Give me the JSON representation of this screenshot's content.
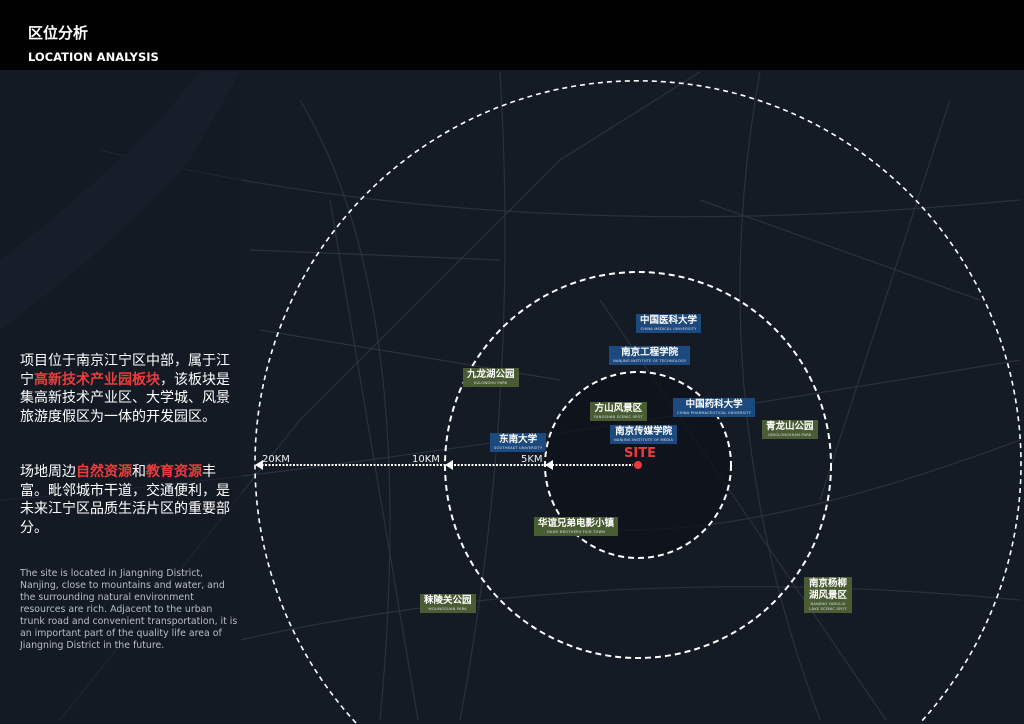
{
  "header": {
    "title_cn": "区位分析",
    "title_en": "LOCATION ANALYSIS"
  },
  "description": {
    "p1_a": "项目位于南京江宁区中部，属于江宁",
    "p1_hl": "高新技术产业园板块",
    "p1_b": "，该板块是集高新技术产业区、大学城、风景旅游度假区为一体的开发园区。",
    "p2_a": "场地周边",
    "p2_hl1": "自然资源",
    "p2_mid": "和",
    "p2_hl2": "教育资源",
    "p2_b": "丰富。毗邻城市干道，交通便利，是未来江宁区品质生活片区的重要部分。",
    "english": "The site is located in Jiangning District, Nanjing, close to mountains and water, and the surrounding natural environment resources are rich. Adjacent to the urban trunk road and convenient transportation, it is an important part of the quality life area of Jiangning District in the future."
  },
  "map": {
    "site_label": "SITE",
    "rings": [
      "5KM",
      "10KM",
      "20KM"
    ],
    "accent": "#ec3b3b",
    "labels": [
      {
        "cn": "中国医科大学",
        "en": "CHINA MEDICAL UNIVERSITY",
        "type": "blue"
      },
      {
        "cn": "南京工程学院",
        "en": "NANJING INSTITUTE OF TECHNOLOGY",
        "type": "blue"
      },
      {
        "cn": "九龙湖公园",
        "en": "JIULONGHU PARK",
        "type": "green"
      },
      {
        "cn": "方山风景区",
        "en": "FANGSHAN SCENIC SPOT",
        "type": "green"
      },
      {
        "cn": "中国药科大学",
        "en": "CHINA PHARMACEUTICAL UNIVERSITY",
        "type": "blue"
      },
      {
        "cn": "青龙山公园",
        "en": "QINGLONGSHAN PARK",
        "type": "green"
      },
      {
        "cn": "南京传媒学院",
        "en": "NANJING INSTITUTE OF MEDIA",
        "type": "blue"
      },
      {
        "cn": "东南大学",
        "en": "SOUTHEAST UNIVERSITY",
        "type": "blue"
      },
      {
        "cn": "华谊兄弟电影小镇",
        "en": "HUAYI BROTHERS FILM TOWN",
        "type": "green"
      },
      {
        "cn": "秣陵关公园",
        "en": "MOLINGGUAN PARK",
        "type": "green"
      },
      {
        "cn": "南京杨柳湖风景区",
        "en": "NANJING YANGLIU LAKE SCENIC SPOT",
        "type": "green"
      }
    ]
  }
}
